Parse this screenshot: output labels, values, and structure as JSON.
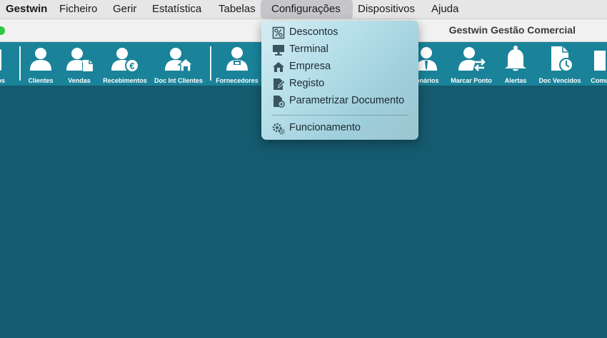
{
  "menubar": {
    "items": [
      {
        "label": "Gestwin"
      },
      {
        "label": "Ficheiro"
      },
      {
        "label": "Gerir"
      },
      {
        "label": "Estatística"
      },
      {
        "label": "Tabelas"
      },
      {
        "label": "Configurações"
      },
      {
        "label": "Dispositivos"
      },
      {
        "label": "Ajuda"
      }
    ],
    "active": "Configurações"
  },
  "window": {
    "title": "Gestwin Gestão Comercial"
  },
  "toolbar": {
    "items": [
      {
        "label": "iços",
        "icon": "services-icon"
      },
      {
        "label": "Clientes",
        "icon": "person-icon"
      },
      {
        "label": "Vendas",
        "icon": "person-document-icon"
      },
      {
        "label": "Recebimentos",
        "icon": "person-euro-icon"
      },
      {
        "label": "Doc Int Clientes",
        "icon": "person-home-icon"
      },
      {
        "label": "Fornecedores",
        "icon": "supplier-icon"
      },
      {
        "label": "ionários",
        "icon": "employee-icon"
      },
      {
        "label": "Marcar Ponto",
        "icon": "person-arrows-icon"
      },
      {
        "label": "Alertas",
        "icon": "bell-icon"
      },
      {
        "label": "Doc Vencidos",
        "icon": "document-clock-icon"
      },
      {
        "label": "Comu",
        "icon": "communications-icon"
      }
    ]
  },
  "dropdown": {
    "items": [
      {
        "label": "Descontos",
        "icon": "percent-icon"
      },
      {
        "label": "Terminal",
        "icon": "monitor-icon"
      },
      {
        "label": "Empresa",
        "icon": "house-icon"
      },
      {
        "label": "Registo",
        "icon": "edit-document-icon"
      },
      {
        "label": "Parametrizar Documento",
        "icon": "document-gear-icon"
      },
      {
        "label": "Funcionamento",
        "icon": "gears-icon"
      }
    ]
  },
  "colors": {
    "toolbar_bg": "#1a8399",
    "main_bg": "#155a6e",
    "menubar_bg": "#e6e6e6",
    "close_dot": "#2bc840"
  }
}
